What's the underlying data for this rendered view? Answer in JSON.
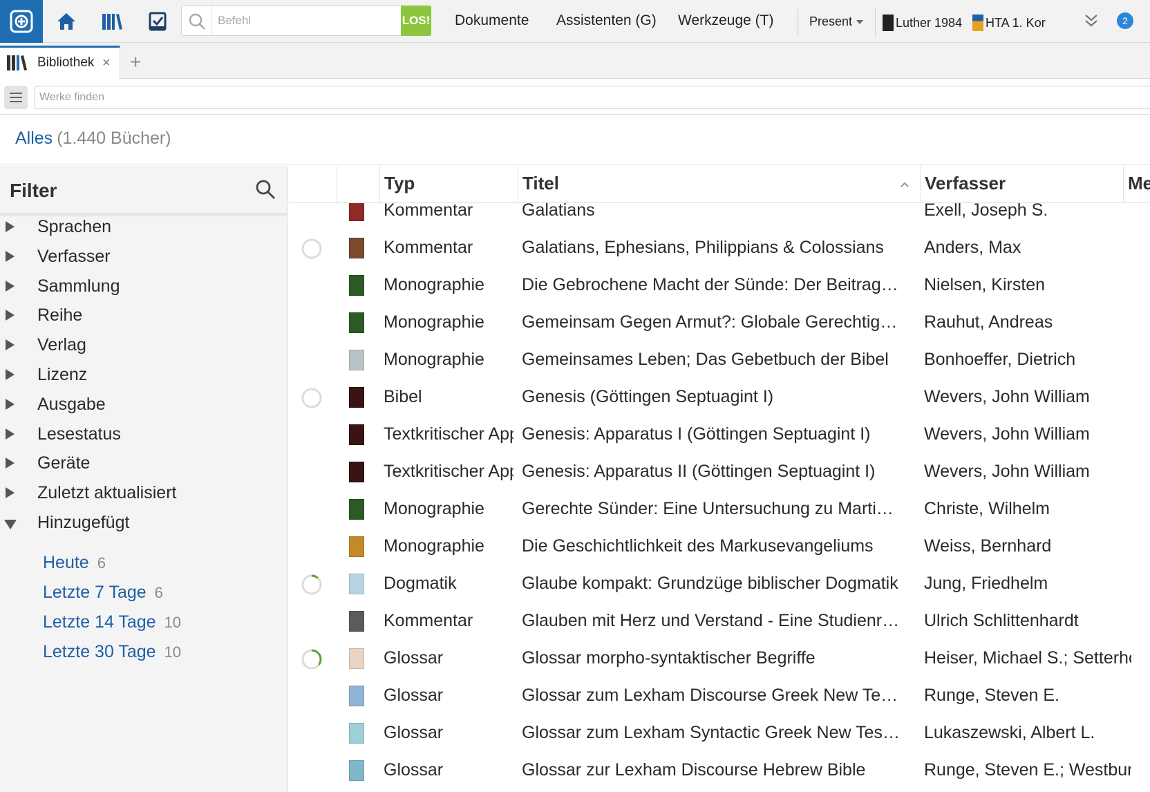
{
  "toolbar": {
    "search_placeholder": "Befehl",
    "go_label": "LOS!",
    "menus": [
      "Dokumente",
      "Assistenten (G)",
      "Werkzeuge (T)"
    ],
    "present_label": "Present",
    "resources": [
      {
        "label": "Luther 1984",
        "color": "#222222"
      },
      {
        "label": "HTA 1. Kor",
        "color": "#e8a21d"
      }
    ],
    "notification_count": "2",
    "icons": [
      "logos-app-icon",
      "home-icon",
      "library-icon",
      "checklist-icon",
      "search-icon",
      "chevron-double-down-icon"
    ]
  },
  "tabs": {
    "items": [
      {
        "label": "Bibliothek",
        "close": "×"
      }
    ],
    "add_label": "+"
  },
  "find": {
    "placeholder": "Werke finden"
  },
  "heading": {
    "scope": "Alles",
    "count": "(1.440 Bücher)"
  },
  "sidebar": {
    "title": "Filter",
    "partial_label": "",
    "groups": [
      {
        "label": "Sprachen",
        "expanded": false
      },
      {
        "label": "Verfasser",
        "expanded": false
      },
      {
        "label": "Sammlung",
        "expanded": false
      },
      {
        "label": "Reihe",
        "expanded": false
      },
      {
        "label": "Verlag",
        "expanded": false
      },
      {
        "label": "Lizenz",
        "expanded": false
      },
      {
        "label": "Ausgabe",
        "expanded": false
      },
      {
        "label": "Lesestatus",
        "expanded": false
      },
      {
        "label": "Geräte",
        "expanded": false
      },
      {
        "label": "Zuletzt aktualisiert",
        "expanded": false
      },
      {
        "label": "Hinzugefügt",
        "expanded": true
      }
    ],
    "added_options": [
      {
        "label": "Heute",
        "count": "6"
      },
      {
        "label": "Letzte 7 Tage",
        "count": "6"
      },
      {
        "label": "Letzte 14 Tage",
        "count": "10"
      },
      {
        "label": "Letzte 30 Tage",
        "count": "10"
      }
    ]
  },
  "table": {
    "columns": [
      "Typ",
      "Titel",
      "Verfasser",
      "Me"
    ],
    "sorted_column": "Titel",
    "sort_direction": "ascending",
    "rows": [
      {
        "typ": "Kommentar",
        "titel": "Galatians",
        "verfasser": "Exell, Joseph S.",
        "cover": "#8f2a24",
        "progress": null
      },
      {
        "typ": "Kommentar",
        "titel": "Galatians, Ephesians, Philippians & Colossians",
        "verfasser": "Anders, Max",
        "cover": "#7a4a2c",
        "progress": 0
      },
      {
        "typ": "Monographie",
        "titel": "Die Gebrochene Macht der Sünde: Der Beitrag Dietrich Bonhoeffers",
        "verfasser": "Nielsen, Kirsten",
        "cover": "#2d5a27",
        "progress": null
      },
      {
        "typ": "Monographie",
        "titel": "Gemeinsam Gegen Armut?: Globale Gerechtigkeit",
        "verfasser": "Rauhut, Andreas",
        "cover": "#2d5a27",
        "progress": null
      },
      {
        "typ": "Monographie",
        "titel": "Gemeinsames Leben; Das Gebetbuch der Bibel",
        "verfasser": "Bonhoeffer, Dietrich",
        "cover": "#b9c3c7",
        "progress": null
      },
      {
        "typ": "Bibel",
        "titel": "Genesis (Göttingen Septuagint I)",
        "verfasser": "Wevers, John William",
        "cover": "#3a1414",
        "progress": 0
      },
      {
        "typ": "Textkritischer Apparat",
        "titel": "Genesis: Apparatus I (Göttingen Septuagint I)",
        "verfasser": "Wevers, John William",
        "cover": "#3a1414",
        "progress": null
      },
      {
        "typ": "Textkritischer Apparat",
        "titel": "Genesis: Apparatus II (Göttingen Septuagint I)",
        "verfasser": "Wevers, John William",
        "cover": "#3a1414",
        "progress": null
      },
      {
        "typ": "Monographie",
        "titel": "Gerechte Sünder: Eine Untersuchung zu Martin Luther",
        "verfasser": "Christe, Wilhelm",
        "cover": "#2d5a27",
        "progress": null
      },
      {
        "typ": "Monographie",
        "titel": "Die Geschichtlichkeit des Markusevangeliums",
        "verfasser": "Weiss, Bernhard",
        "cover": "#c48a2a",
        "progress": null
      },
      {
        "typ": "Dogmatik",
        "titel": "Glaube kompakt: Grundzüge biblischer Dogmatik",
        "verfasser": "Jung, Friedhelm",
        "cover": "#b8d4e3",
        "progress": 0.12
      },
      {
        "typ": "Kommentar",
        "titel": "Glauben mit Herz und Verstand - Eine Studienreihe",
        "verfasser": "Ulrich Schlittenhardt",
        "cover": "#5b5b5b",
        "progress": null
      },
      {
        "typ": "Glossar",
        "titel": "Glossar morpho-syntaktischer Begriffe",
        "verfasser": "Heiser, Michael S.; Setterholm, Vincent M.",
        "cover": "#e9d5c6",
        "progress": 0.35
      },
      {
        "typ": "Glossar",
        "titel": "Glossar zum Lexham Discourse Greek New Testament",
        "verfasser": "Runge, Steven E.",
        "cover": "#8fb4d8",
        "progress": null
      },
      {
        "typ": "Glossar",
        "titel": "Glossar zum Lexham Syntactic Greek New Testament",
        "verfasser": "Lukaszewski, Albert L.",
        "cover": "#9fd0d8",
        "progress": null
      },
      {
        "typ": "Glossar",
        "titel": "Glossar zur Lexham Discourse Hebrew Bible",
        "verfasser": "Runge, Steven E.; Westbury, Joshua R.",
        "cover": "#7fb8c8",
        "progress": null
      }
    ]
  }
}
